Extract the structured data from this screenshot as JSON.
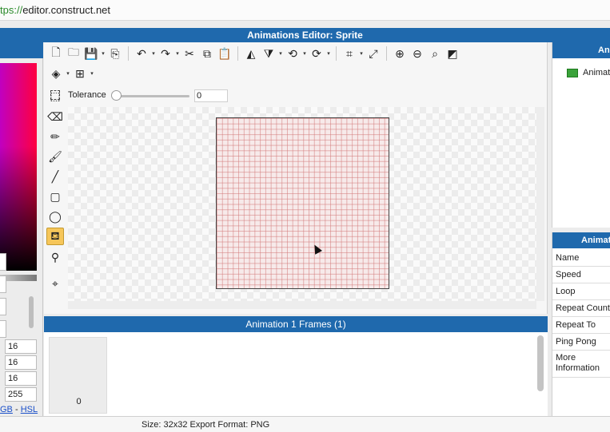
{
  "browser": {
    "url_scheme": "tps://",
    "url_rest": "editor.construct.net"
  },
  "window": {
    "title": "Animations Editor: Sprite"
  },
  "toolbar": {
    "row1": [
      {
        "name": "new-file-icon",
        "glyph": "🗋"
      },
      {
        "name": "open-folder-icon",
        "glyph": "🗀"
      },
      {
        "name": "save-icon",
        "glyph": "💾",
        "dropdown": true
      },
      {
        "name": "export-icon",
        "glyph": "⎘"
      },
      {
        "sep": true
      },
      {
        "name": "undo-icon",
        "glyph": "↶",
        "dropdown": true
      },
      {
        "name": "redo-icon",
        "glyph": "↷",
        "dropdown": true
      },
      {
        "name": "cut-icon",
        "glyph": "✂"
      },
      {
        "name": "copy-icon",
        "glyph": "⧉"
      },
      {
        "name": "paste-icon",
        "glyph": "📋"
      },
      {
        "sep": true
      },
      {
        "name": "flip-horizontal-icon",
        "glyph": "◭"
      },
      {
        "name": "flip-vertical-icon",
        "glyph": "⧩",
        "dropdown": true
      },
      {
        "name": "rotate-ccw-icon",
        "glyph": "⟲",
        "dropdown": true
      },
      {
        "name": "rotate-cw-icon",
        "glyph": "⟳",
        "dropdown": true
      },
      {
        "sep": true
      },
      {
        "name": "crop-icon",
        "glyph": "⌗",
        "dropdown": true
      },
      {
        "name": "resize-icon",
        "glyph": "⤢"
      },
      {
        "sep": true
      },
      {
        "name": "zoom-in-icon",
        "glyph": "⊕"
      },
      {
        "name": "zoom-out-icon",
        "glyph": "⊖"
      },
      {
        "name": "zoom-reset-icon",
        "glyph": "⌕"
      },
      {
        "name": "toggle-background-icon",
        "glyph": "◩"
      }
    ],
    "row2": [
      {
        "name": "layers-icon",
        "glyph": "◈",
        "dropdown": true
      },
      {
        "name": "grid-icon",
        "glyph": "⊞",
        "dropdown": true
      }
    ]
  },
  "tolerance": {
    "label": "Tolerance",
    "value": "0"
  },
  "tools": [
    {
      "name": "rectangle-select-tool-icon",
      "glyph": "⬚",
      "active": false
    },
    {
      "name": "eraser-tool-icon",
      "glyph": "⌫",
      "active": false
    },
    {
      "name": "pencil-tool-icon",
      "glyph": "✏",
      "active": false
    },
    {
      "name": "brush-tool-icon",
      "glyph": "🖌",
      "active": false
    },
    {
      "name": "line-tool-icon",
      "glyph": "╱",
      "active": false
    },
    {
      "name": "rectangle-tool-icon",
      "glyph": "▢",
      "active": false
    },
    {
      "name": "ellipse-tool-icon",
      "glyph": "◯",
      "active": false
    },
    {
      "name": "fill-bucket-tool-icon",
      "glyph": "⛾",
      "active": true
    },
    {
      "name": "color-picker-tool-icon",
      "glyph": "⚲",
      "active": false
    },
    {
      "name": "origin-tool-icon",
      "glyph": "⌖",
      "active": false
    }
  ],
  "color_panel": {
    "fields": [
      "16",
      "16",
      "16",
      "255"
    ],
    "link_rgb": "GB",
    "link_sep": " - ",
    "link_hsl": "HSL"
  },
  "frames": {
    "title": "Animation 1 Frames (1)",
    "frame_numbers": [
      "0"
    ]
  },
  "status": {
    "text": "Size: 32x32   Export Format: PNG"
  },
  "animations_panel": {
    "header": "Ani",
    "items": [
      "Animat"
    ]
  },
  "properties_panel": {
    "header": "Animati",
    "rows": [
      "Name",
      "Speed",
      "Loop",
      "Repeat Count",
      "Repeat To",
      "Ping Pong",
      "More Information"
    ]
  }
}
